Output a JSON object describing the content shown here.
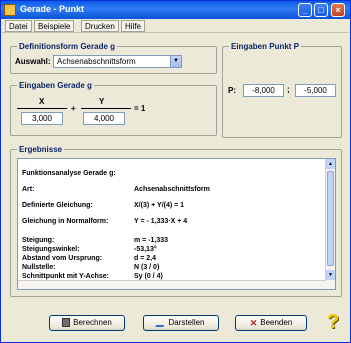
{
  "window": {
    "title": "Gerade - Punkt"
  },
  "menu": {
    "items": [
      "Datei",
      "Beispiele",
      "Drucken",
      "Hilfe"
    ]
  },
  "definition": {
    "group_title": "Definitionsform Gerade g",
    "auswahl_label": "Auswahl:",
    "auswahl_value": "Achsenabschnittsform"
  },
  "point": {
    "group_title": "Eingaben Punkt P",
    "label": "P:",
    "x": "-8,000",
    "separator": ";",
    "y": "-5,000"
  },
  "line_input": {
    "group_title": "Eingaben Gerade g",
    "x_label": "X",
    "y_label": "Y",
    "plus": "+",
    "equals": "= 1",
    "x_denominator": "3,000",
    "y_denominator": "4,000"
  },
  "results": {
    "group_title": "Ergebnisse",
    "heading": "Funktionsanalyse Gerade g:",
    "rows": [
      {
        "label": "Art:",
        "value": "Achsenabschnittsform"
      },
      {
        "label": "Definierte Gleichung:",
        "value": "X/(3) + Y/(4) = 1"
      },
      {
        "label": "Gleichung in Normalform:",
        "value": "Y = - 1,333·X + 4"
      },
      {
        "label": "Steigung:",
        "value": "m = -1,333"
      },
      {
        "label": "Steigungswinkel:",
        "value": "-53,13°"
      },
      {
        "label": "Abstand vom Ursprung:",
        "value": "d = 2,4"
      },
      {
        "label": "Nullstelle:",
        "value": "N (3 / 0)"
      },
      {
        "label": "Schnittpunkt mit Y-Achse:",
        "value": "Sy (0 / 4)"
      }
    ]
  },
  "buttons": {
    "berechnen": "Berechnen",
    "darstellen": "Darstellen",
    "beenden": "Beenden"
  }
}
